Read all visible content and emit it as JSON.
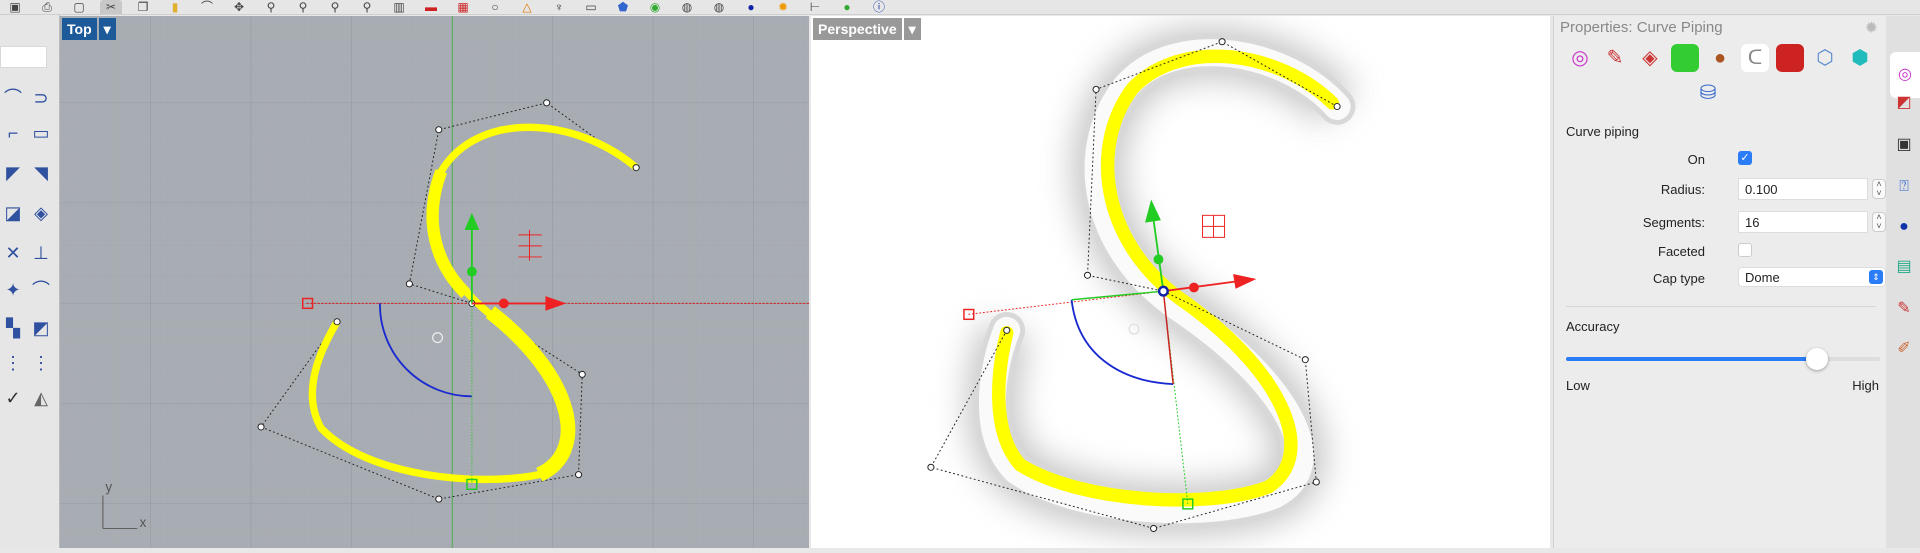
{
  "toolbar": {
    "icons": [
      "save-icon",
      "print-icon",
      "new-icon",
      "cut-icon",
      "copy-icon",
      "paste-icon",
      "curve-icon",
      "point-icon",
      "zoom-icon",
      "zoom-window-icon",
      "zoom-extents-icon",
      "zoom-selected-icon",
      "viewport-layout-icon",
      "car-icon",
      "grid-icon",
      "circle-icon",
      "dimension-icon",
      "light-icon",
      "rectangle-icon",
      "shield-icon",
      "color-wheel-icon",
      "sphere-icon",
      "render-icon",
      "globe-icon",
      "gear-icon",
      "distance-icon",
      "render-color-icon",
      "info-icon"
    ]
  },
  "viewports": {
    "top": {
      "label": "Top",
      "axis_x": "x",
      "axis_y": "y"
    },
    "perspective": {
      "label": "Perspective"
    }
  },
  "properties": {
    "title": "Properties: Curve Piping",
    "section": "Curve piping",
    "on_label": "On",
    "on_checked": true,
    "radius_label": "Radius:",
    "radius_value": "0.100",
    "segments_label": "Segments:",
    "segments_value": "16",
    "faceted_label": "Faceted",
    "faceted_checked": false,
    "cap_label": "Cap type",
    "cap_value": "Dome",
    "accuracy_label": "Accuracy",
    "accuracy_value": 0.8,
    "low_label": "Low",
    "high_label": "High"
  },
  "colors": {
    "accent": "#2a7cf7",
    "viewport_active": "#1c5a9a",
    "pipe": "#ffff00"
  }
}
